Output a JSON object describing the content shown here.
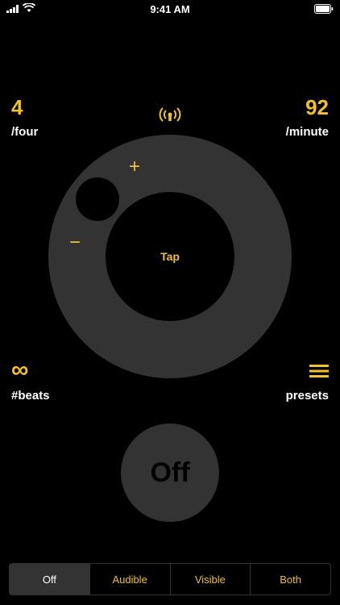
{
  "status_bar": {
    "time": "9:41 AM",
    "icons": [
      "signal-icon",
      "wifi-icon",
      "battery-icon"
    ]
  },
  "meter": {
    "value": "4",
    "label": "/four"
  },
  "tempo": {
    "value": "92",
    "label": "/minute"
  },
  "dial": {
    "plus": "+",
    "minus": "−",
    "tap_label": "Tap",
    "sound_icon": "vibrate-icon"
  },
  "beats": {
    "symbol": "∞",
    "label": "#beats"
  },
  "presets": {
    "icon": "menu-icon",
    "label": "presets"
  },
  "power": {
    "label": "Off"
  },
  "mode_tabs": {
    "items": [
      "Off",
      "Audible",
      "Visible",
      "Both"
    ],
    "selected": "Off"
  },
  "colors": {
    "accent": "#f2c12e",
    "surface": "#333333",
    "background": "#000000"
  }
}
